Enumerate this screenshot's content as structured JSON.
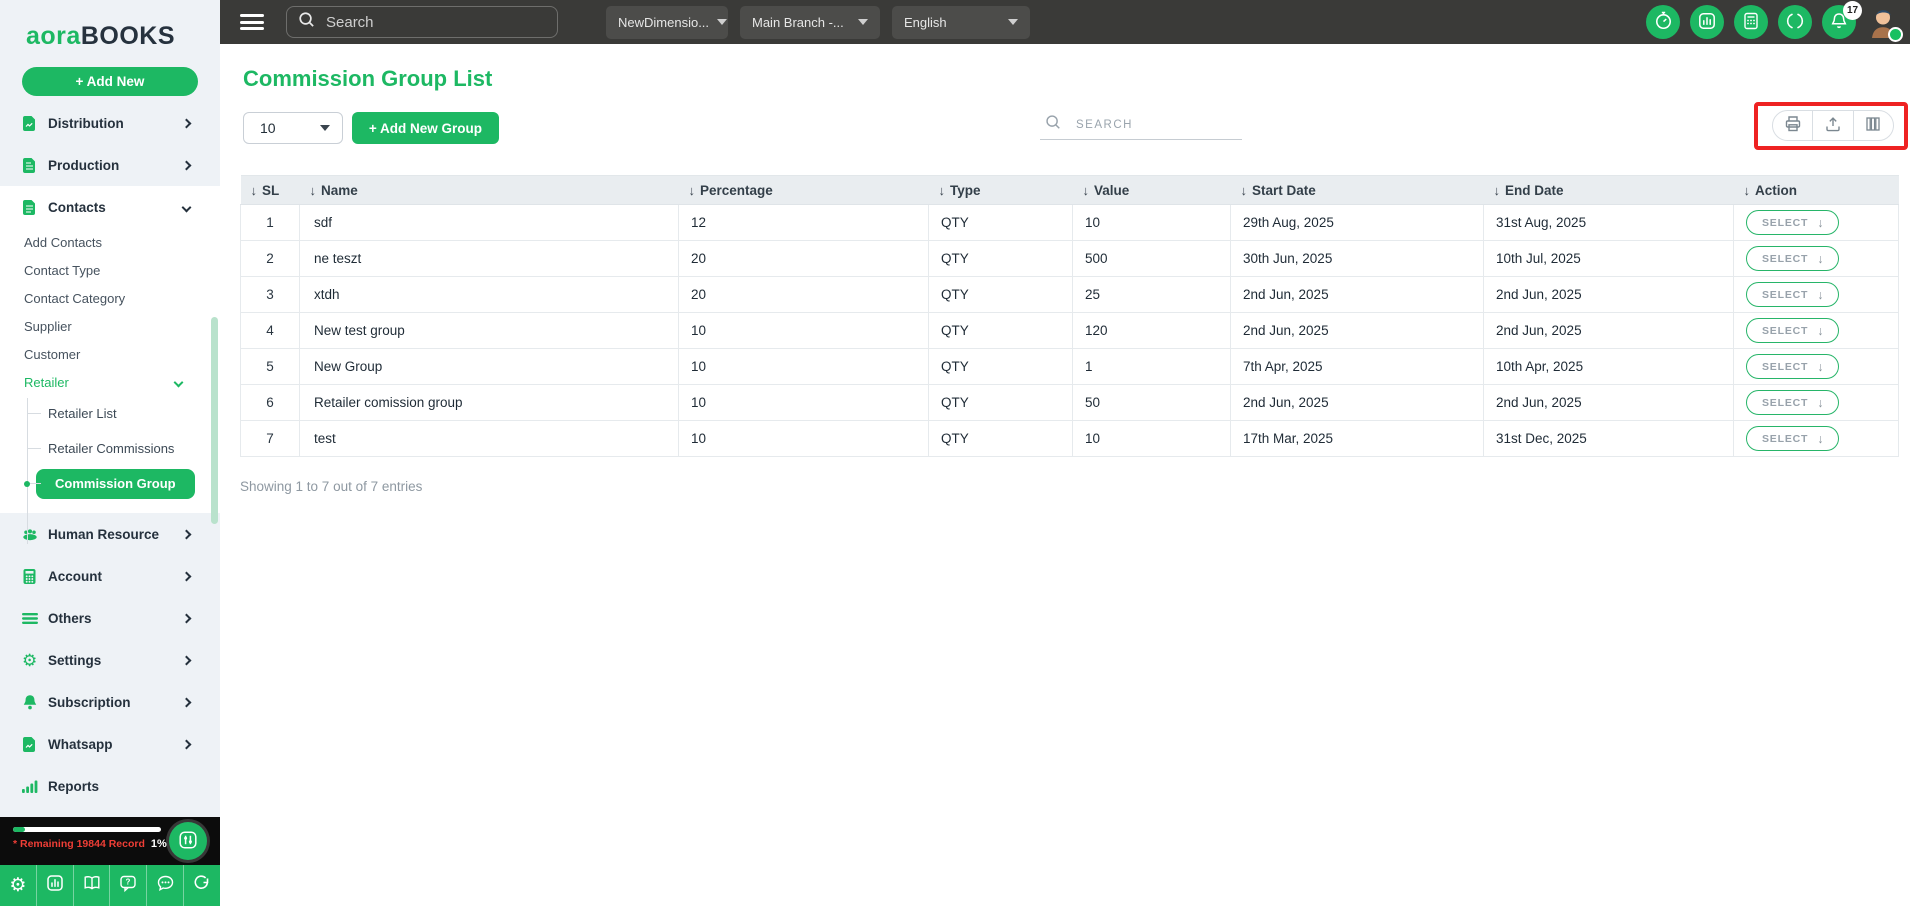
{
  "logo": {
    "part1": "aora",
    "part2": "BOOKS"
  },
  "sidebar": {
    "add_new": "+ Add New",
    "items_top": [
      {
        "label": "Distribution",
        "icon": "document-icon"
      },
      {
        "label": "Production",
        "icon": "document-icon"
      },
      {
        "label": "Contacts",
        "icon": "document-icon"
      }
    ],
    "contacts_children": [
      "Add Contacts",
      "Contact Type",
      "Contact Category",
      "Supplier",
      "Customer"
    ],
    "retailer": {
      "label": "Retailer",
      "children": [
        "Retailer List",
        "Retailer Commissions",
        "Commission Group"
      ],
      "active_child": "Commission Group"
    },
    "items_bottom": [
      {
        "label": "Human Resource",
        "icon": "people-icon"
      },
      {
        "label": "Account",
        "icon": "calculator-icon"
      },
      {
        "label": "Others",
        "icon": "menu-lines-icon"
      },
      {
        "label": "Settings",
        "icon": "gear-icon"
      },
      {
        "label": "Subscription",
        "icon": "bell-icon"
      },
      {
        "label": "Whatsapp",
        "icon": "document-icon"
      },
      {
        "label": "Reports",
        "icon": "bar-chart-icon"
      }
    ],
    "status": {
      "remaining": "* Remaining 19844 Record",
      "percent": "1%"
    }
  },
  "topbar": {
    "search_placeholder": "Search",
    "company_dropdown": "NewDimensio...",
    "branch_dropdown": "Main Branch -...",
    "language_dropdown": "English",
    "notification_count": "17"
  },
  "page": {
    "title": "Commission Group List",
    "page_size": "10",
    "add_button": "+ Add New Group",
    "search_placeholder": "SEARCH",
    "summary": "Showing 1 to 7 out of 7 entries"
  },
  "table": {
    "columns": [
      "SL",
      "Name",
      "Percentage",
      "Type",
      "Value",
      "Start Date",
      "End Date",
      "Action"
    ],
    "select_label": "SELECT",
    "rows": [
      {
        "sl": "1",
        "name": "sdf",
        "percentage": "12",
        "type": "QTY",
        "value": "10",
        "start": "29th Aug, 2025",
        "end": "31st Aug, 2025"
      },
      {
        "sl": "2",
        "name": "ne teszt",
        "percentage": "20",
        "type": "QTY",
        "value": "500",
        "start": "30th Jun, 2025",
        "end": "10th Jul, 2025"
      },
      {
        "sl": "3",
        "name": "xtdh",
        "percentage": "20",
        "type": "QTY",
        "value": "25",
        "start": "2nd Jun, 2025",
        "end": "2nd Jun, 2025"
      },
      {
        "sl": "4",
        "name": "New test group",
        "percentage": "10",
        "type": "QTY",
        "value": "120",
        "start": "2nd Jun, 2025",
        "end": "2nd Jun, 2025"
      },
      {
        "sl": "5",
        "name": "New Group",
        "percentage": "10",
        "type": "QTY",
        "value": "1",
        "start": "7th Apr, 2025",
        "end": "10th Apr, 2025"
      },
      {
        "sl": "6",
        "name": "Retailer comission group",
        "percentage": "10",
        "type": "QTY",
        "value": "50",
        "start": "2nd Jun, 2025",
        "end": "2nd Jun, 2025"
      },
      {
        "sl": "7",
        "name": "test",
        "percentage": "10",
        "type": "QTY",
        "value": "10",
        "start": "17th Mar, 2025",
        "end": "31st Dec, 2025"
      }
    ]
  },
  "icons": {
    "sort": "↓",
    "select_arrow": "↓",
    "gear_glyph": "⚙"
  },
  "colors": {
    "primary_green": "#1db863",
    "annotation_red": "#ee2222",
    "topbar_bg": "#3a3a38"
  }
}
